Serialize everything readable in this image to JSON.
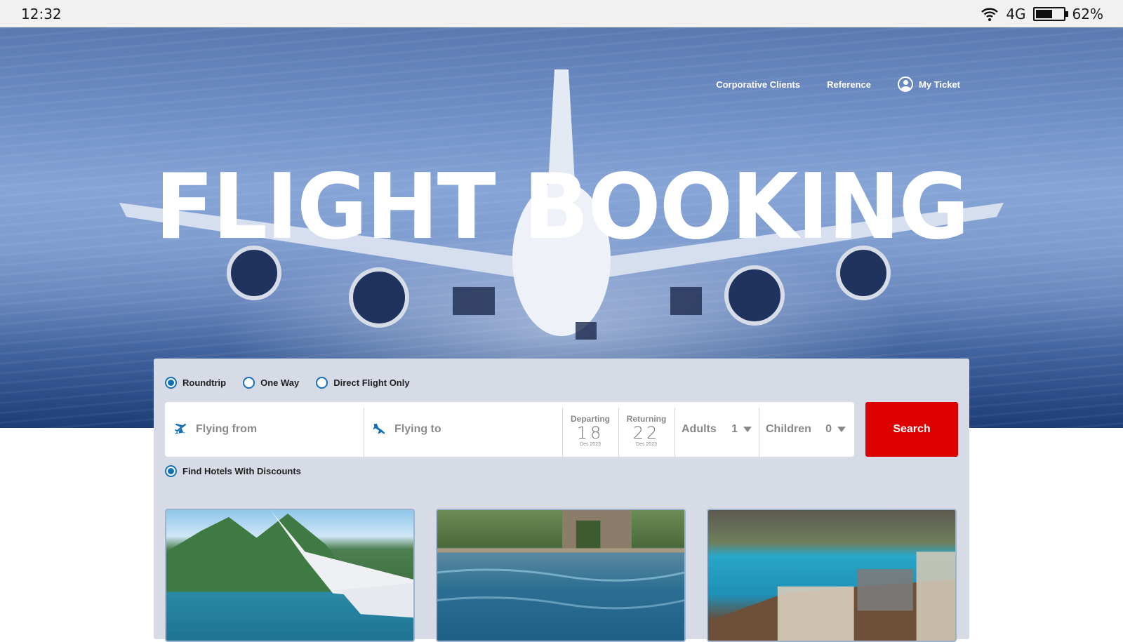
{
  "status_bar": {
    "time": "12:32",
    "network": "4G",
    "battery_percent_label": "62%",
    "battery_level": 0.62,
    "icons": [
      "wifi-icon",
      "battery-icon"
    ]
  },
  "hero": {
    "title": "FLIGHT BOOKING",
    "nav": [
      {
        "label": "Corporative Clients"
      },
      {
        "label": "Reference"
      },
      {
        "label": "My Ticket",
        "icon": "user-icon"
      }
    ]
  },
  "booking": {
    "trip_types": [
      {
        "label": "Roundtrip",
        "checked": true
      },
      {
        "label": "One Way",
        "checked": false
      },
      {
        "label": "Direct Flight Only",
        "checked": false
      }
    ],
    "from": {
      "placeholder": "Flying from",
      "icon": "plane-takeoff-icon"
    },
    "to": {
      "placeholder": "Flying to",
      "icon": "plane-landing-icon"
    },
    "departing": {
      "label": "Departing",
      "day": "18",
      "month_year": "Dec 2023"
    },
    "returning": {
      "label": "Returning",
      "day": "22",
      "month_year": "Dec 2023"
    },
    "adults": {
      "label": "Adults",
      "value": "1"
    },
    "children": {
      "label": "Children",
      "value": "0"
    },
    "search_label": "Search",
    "accent_color": "#dd0000",
    "radio_color": "#1670b6",
    "hotels_option": {
      "label": "Find Hotels With Discounts",
      "checked": true
    }
  },
  "cards": [
    {
      "name": "mountain-lake-wing"
    },
    {
      "name": "resort-pool-garden"
    },
    {
      "name": "hotel-pool-lounge"
    }
  ]
}
